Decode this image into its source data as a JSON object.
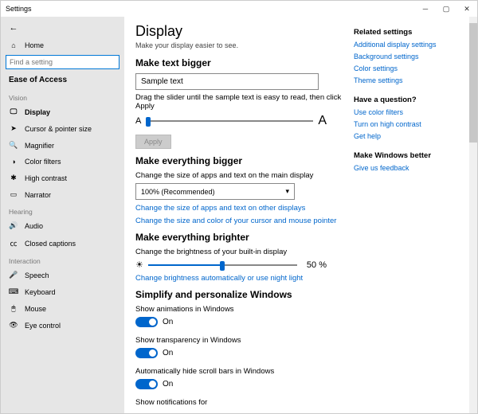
{
  "titlebar": {
    "title": "Settings"
  },
  "sidebar": {
    "home": "Home",
    "search_placeholder": "Find a setting",
    "group": "Ease of Access",
    "groups": [
      {
        "label": "Vision",
        "items": [
          "Display",
          "Cursor & pointer size",
          "Magnifier",
          "Color filters",
          "High contrast",
          "Narrator"
        ]
      },
      {
        "label": "Hearing",
        "items": [
          "Audio",
          "Closed captions"
        ]
      },
      {
        "label": "Interaction",
        "items": [
          "Speech",
          "Keyboard",
          "Mouse",
          "Eye control"
        ]
      }
    ]
  },
  "main": {
    "title": "Display",
    "subtitle": "Make your display easier to see.",
    "sec_text_bigger": "Make text bigger",
    "sample_value": "Sample text",
    "drag_hint": "Drag the slider until the sample text is easy to read, then click Apply",
    "apply": "Apply",
    "sec_everything_bigger": "Make everything bigger",
    "change_size_label": "Change the size of apps and text on the main display",
    "scale_value": "100% (Recommended)",
    "link_other_displays": "Change the size of apps and text on other displays",
    "link_cursor": "Change the size and color of your cursor and mouse pointer",
    "sec_brighter": "Make everything brighter",
    "brightness_label": "Change the brightness of your built-in display",
    "brightness_percent": "50 %",
    "link_nightlight": "Change brightness automatically or use night light",
    "sec_simplify": "Simplify and personalize Windows",
    "toggle_anim_label": "Show animations in Windows",
    "toggle_trans_label": "Show transparency in Windows",
    "toggle_scroll_label": "Automatically hide scroll bars in Windows",
    "toggle_notif_label": "Show notifications for",
    "on": "On"
  },
  "right": {
    "related_title": "Related settings",
    "links1": [
      "Additional display settings",
      "Background settings",
      "Color settings",
      "Theme settings"
    ],
    "question_title": "Have a question?",
    "links2": [
      "Use color filters",
      "Turn on high contrast",
      "Get help"
    ],
    "better_title": "Make Windows better",
    "links3": [
      "Give us feedback"
    ]
  }
}
